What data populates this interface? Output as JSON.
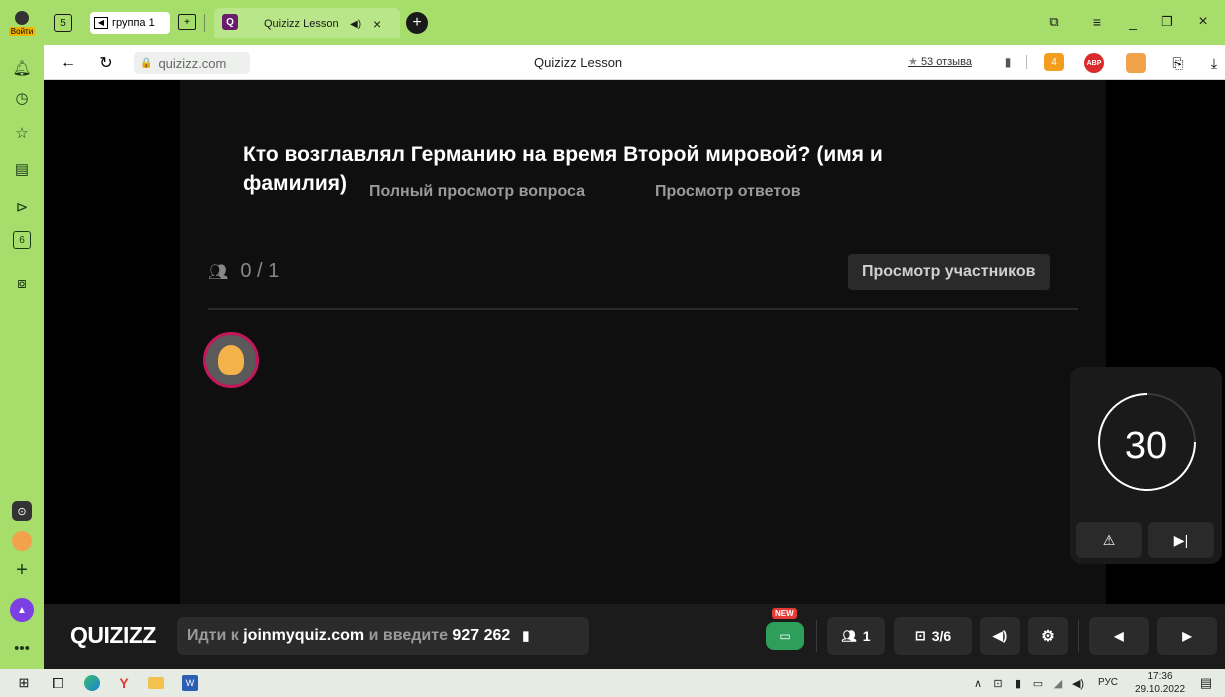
{
  "browser": {
    "login_label": "Войти",
    "tab_badge_count": "5",
    "group_tab_label": "группа 1",
    "active_tab_title": "Quizizz Lesson",
    "address": "quizizz.com",
    "page_title": "Quizizz Lesson",
    "reviews_label": "53 отзыва",
    "adblock_label": "ABP",
    "sidebar_badge": "6"
  },
  "quiz": {
    "question": "Кто возглавлял Германию на время Второй мировой? (имя и фамилия)",
    "responses_count": "0 / 1",
    "tabs": [
      {
        "label": "Полный просмотр вопроса"
      },
      {
        "label": "Просмотр ответов"
      },
      {
        "label": "Просмотр участников"
      }
    ],
    "timer_value": "30"
  },
  "footer": {
    "logo": "QUIZIZZ",
    "join_prefix": "Идти к",
    "join_site": "joinmyquiz.com",
    "join_middle": "и введите",
    "join_code": "927 262",
    "new_badge": "NEW",
    "players_count": "1",
    "slide_counter": "3/6"
  },
  "taskbar": {
    "lang": "РУС",
    "time": "17:36",
    "date": "29.10.2022"
  },
  "colors": {
    "browser_green": "#a7dd6a",
    "stage_bg": "#0f0f0f",
    "footer_bg": "#1b1b1b",
    "new_badge_red": "#e53935",
    "screen_share_green": "#2e9e5b"
  }
}
